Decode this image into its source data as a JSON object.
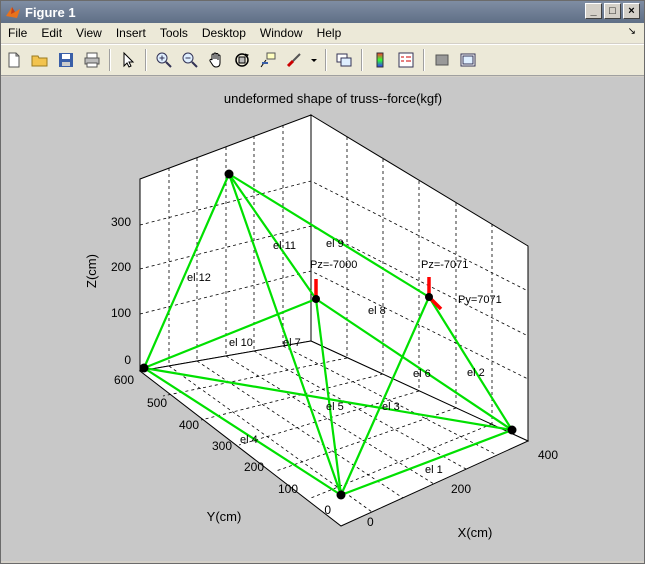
{
  "window": {
    "title": "Figure 1",
    "buttons": [
      "_",
      "□",
      "×"
    ]
  },
  "menubar": {
    "items": [
      "File",
      "Edit",
      "View",
      "Insert",
      "Tools",
      "Desktop",
      "Window",
      "Help"
    ]
  },
  "toolbar": {
    "tools": [
      "new-file-icon",
      "open-folder-icon",
      "save-icon",
      "print-icon",
      "pointer-icon",
      "zoom-in-icon",
      "zoom-out-icon",
      "pan-hand-icon",
      "rotate-3d-icon",
      "data-cursor-icon",
      "brush-icon",
      "link-plot-icon",
      "colorbar-icon",
      "legend-icon",
      "hide-plot-tools-icon",
      "show-plot-tools-icon"
    ]
  },
  "chart_data": {
    "type": "3d-line",
    "title": "undeformed shape of truss--force(kgf)",
    "xlabel": "X(cm)",
    "ylabel": "Y(cm)",
    "zlabel": "Z(cm)",
    "x_ticks": [
      "0",
      "200",
      "400"
    ],
    "y_ticks": [
      "0",
      "100",
      "200",
      "300",
      "400",
      "500",
      "600"
    ],
    "z_ticks": [
      "0",
      "100",
      "200",
      "300"
    ],
    "element_labels": [
      "el 1",
      "el 2",
      "el 3",
      "el 4",
      "el 5",
      "el 6",
      "el 7",
      "el 8",
      "el 9",
      "el 10",
      "el 11",
      "el 12"
    ],
    "load_labels": [
      "Pz=-7000",
      "Pz=-7071",
      "Py=7071"
    ],
    "colors": {
      "members": "#00e000",
      "nodes": "#000000",
      "loads": "#ff0000",
      "axes_bg": "#ffffff",
      "figure_bg": "#c8c8c8"
    }
  }
}
